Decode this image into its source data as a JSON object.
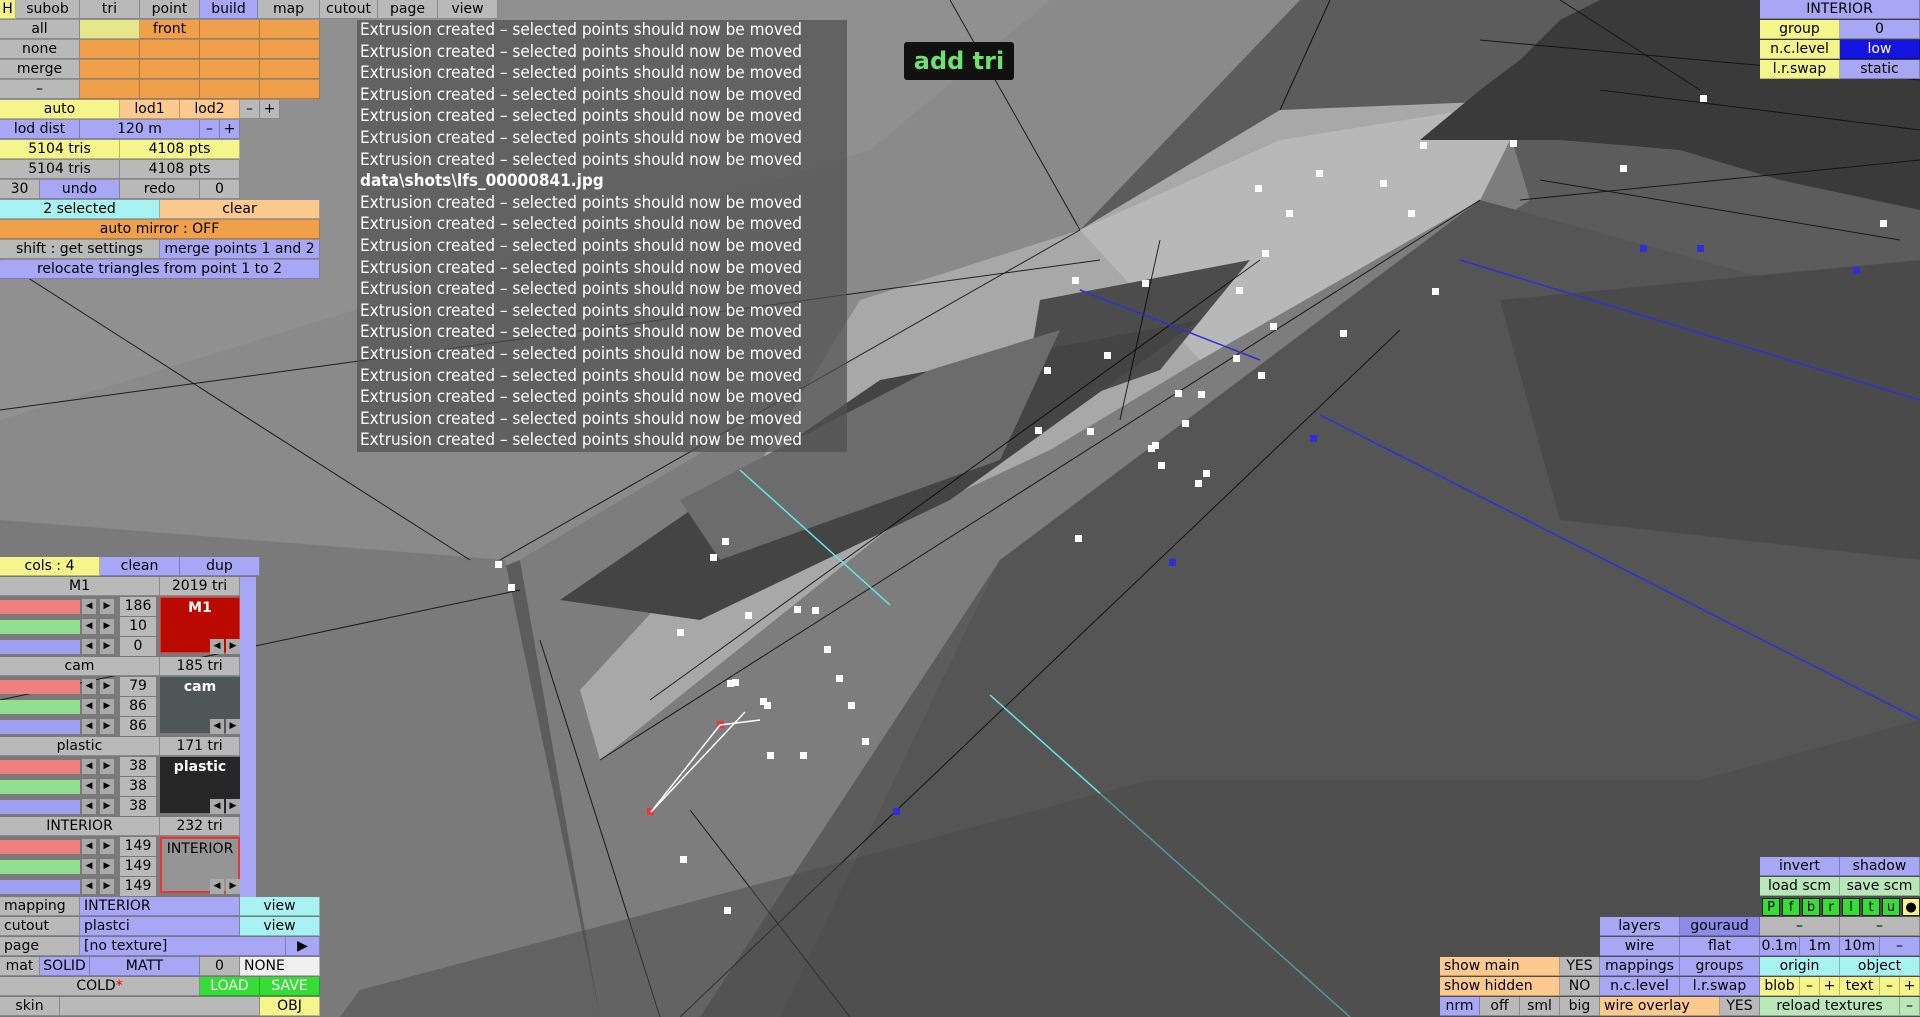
{
  "top_menu": [
    "H",
    "subob",
    "tri",
    "point",
    "build",
    "map",
    "cutout",
    "page",
    "view"
  ],
  "select_panel": {
    "all": "all",
    "none": "none",
    "merge": "merge",
    "minus": "–",
    "front": "front"
  },
  "lod": {
    "auto": "auto",
    "lod1": "lod1",
    "lod2": "lod2",
    "minus": "–",
    "plus": "+",
    "lod_dist_label": "lod dist",
    "lod_dist_value": "120 m",
    "dist_minus": "–",
    "dist_plus": "+"
  },
  "stats": {
    "tris1": "5104 tris",
    "pts1": "4108 pts",
    "tris2": "5104 tris",
    "pts2": "4108 pts"
  },
  "undo_row": {
    "count": "30",
    "undo": "undo",
    "redo": "redo",
    "redo_count": "0"
  },
  "selection": {
    "selected": "2 selected",
    "clear": "clear",
    "auto_mirror": "auto mirror : OFF",
    "shift_settings": "shift : get settings",
    "merge_points": "merge points 1 and 2",
    "relocate": "relocate triangles from point 1 to 2"
  },
  "log_lines": [
    "Extrusion created – selected points should now be moved",
    "Extrusion created – selected points should now be moved",
    "Extrusion created – selected points should now be moved",
    "Extrusion created – selected points should now be moved",
    "Extrusion created – selected points should now be moved",
    "Extrusion created – selected points should now be moved",
    "Extrusion created – selected points should now be moved",
    "data\\shots\\lfs_00000841.jpg",
    "Extrusion created – selected points should now be moved",
    "Extrusion created – selected points should now be moved",
    "Extrusion created – selected points should now be moved",
    "Extrusion created – selected points should now be moved",
    "Extrusion created – selected points should now be moved",
    "Extrusion created – selected points should now be moved",
    "Extrusion created – selected points should now be moved",
    "Extrusion created – selected points should now be moved",
    "Extrusion created – selected points should now be moved",
    "Extrusion created – selected points should now be moved",
    "Extrusion created – selected points should now be moved",
    "Extrusion created – selected points should now be moved"
  ],
  "mode_label": "add tri",
  "top_right": {
    "title": "INTERIOR",
    "group_label": "group",
    "group_value": "0",
    "nclevel_label": "n.c.level",
    "nclevel_value": "low",
    "lrswap_label": "l.r.swap",
    "lrswap_value": "static"
  },
  "cols_row": {
    "cols": "cols : 4",
    "clean": "clean",
    "dup": "dup"
  },
  "materials": [
    {
      "name": "M1",
      "tris": "2019 tri",
      "r": "186",
      "g": "10",
      "b": "0",
      "swatch_label": "M1",
      "color": "#ba0a00"
    },
    {
      "name": "cam",
      "tris": "185 tri",
      "r": "79",
      "g": "86",
      "b": "86",
      "swatch_label": "cam",
      "color": "#4f5656"
    },
    {
      "name": "plastic",
      "tris": "171 tri",
      "r": "38",
      "g": "38",
      "b": "38",
      "swatch_label": "plastic",
      "color": "#262626"
    },
    {
      "name": "INTERIOR",
      "tris": "232 tri",
      "r": "149",
      "g": "149",
      "b": "149",
      "swatch_label": "INTERIOR",
      "color": "#959595"
    }
  ],
  "bottom_left": {
    "mapping_label": "mapping",
    "mapping_value": "INTERIOR",
    "mapping_view": "view",
    "cutout_label": "cutout",
    "cutout_value": "plastci",
    "cutout_view": "view",
    "page_label": "page",
    "page_value": "[no texture]",
    "page_arrow": "▶",
    "mat_label": "mat",
    "mat_solid": "SOLID",
    "mat_matt": "MATT",
    "mat_num": "0",
    "mat_none": "NONE",
    "cold_label": "COLD",
    "load": "LOAD",
    "save": "SAVE",
    "skin_label": "skin",
    "skin_value": "",
    "obj": "OBJ"
  },
  "bottom_right": {
    "invert": "invert",
    "shadow": "shadow",
    "load_scm": "load scm",
    "save_scm": "save scm",
    "pills": [
      "P",
      "f",
      "b",
      "r",
      "l",
      "t",
      "u",
      "●"
    ],
    "dash1": "–",
    "dash2": "–",
    "layers": "layers",
    "gouraud": "gouraud",
    "wire": "wire",
    "flat": "flat",
    "d01": "0.1m",
    "d1": "1m",
    "d10": "10m",
    "dminus": "–",
    "show_main": "show main",
    "show_main_v": "YES",
    "mappings": "mappings",
    "groups": "groups",
    "origin": "origin",
    "object": "object",
    "show_hidden": "show hidden",
    "show_hidden_v": "NO",
    "nclevel": "n.c.level",
    "lrswap": "l.r.swap",
    "blob": "blob",
    "bminus": "–",
    "bplus": "+",
    "text": "text",
    "tminus": "–",
    "tplus": "+",
    "nrm": "nrm",
    "off": "off",
    "sml": "sml",
    "big": "big",
    "wire_overlay": "wire overlay",
    "wire_overlay_v": "YES",
    "reload_textures": "reload textures",
    "rminus": "–"
  }
}
